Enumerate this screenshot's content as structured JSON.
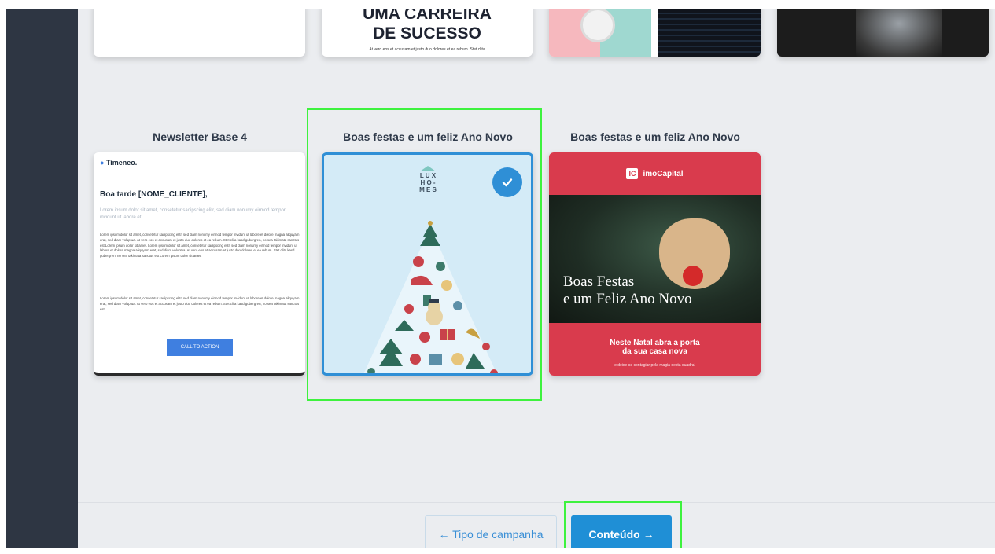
{
  "top_row": {
    "career_card": {
      "heading_line1": "UMA CARREIRA",
      "heading_line2": "DE SUCESSO",
      "caption": "At vero eos et accusam et justo duo dolores et ea rebum. Stet clita"
    }
  },
  "templates": [
    {
      "title": "Newsletter Base 4",
      "selected": false,
      "logo": "Timeneo.",
      "greeting": "Boa tarde [NOME_CLIENTE],",
      "lead": "Lorem ipsum dolor sit amet, consetetur sadipscing elitr, sed diam nonumy eirmod tempor invidunt ut labore et.",
      "body1": "Lorem ipsum dolor sit amet, consetetur sadipscing elitr, sed diam nonumy eirmod tempor invidunt ut labore et dolore magna aliquyam erat, sed diam voluptua. At vero eos et accusam et justo duo dolores et ea rebum. Stet clita kasd gubergren, no sea takimata sanctus est Lorem ipsum dolor sit amet. Lorem ipsum dolor sit amet, consetetur sadipscing elitr, sed diam nonumy eirmod tempor invidunt ut labore et dolore magna aliquyam erat, sed diam voluptua. At vero eos et accusam et justo duo dolores et ea rebum. Stet clita kasd gubergren, no sea takimata sanctus est Lorem ipsum dolor sit amet.",
      "body2": "Lorem ipsum dolor sit amet, consetetur sadipscing elitr, sed diam nonumy eirmod tempor invidunt ut labore et dolore magna aliquyam erat, sed diam voluptua. At vero eos et accusam et justo duo dolores et ea rebum. Stet clita kasd gubergren, no sea takimata sanctus est.",
      "cta": "CALL TO ACTION"
    },
    {
      "title": "Boas festas e um feliz Ano Novo",
      "selected": true,
      "logo_lines": [
        "L U X",
        "H O -",
        "M E S"
      ],
      "background": "#d4ebf7"
    },
    {
      "title": "Boas festas e um feliz Ano Novo",
      "selected": false,
      "brand_mark": "IC",
      "brand_name": "imoCapital",
      "headline_line1": "Boas Festas",
      "headline_line2": "e um Feliz Ano Novo",
      "sub_line1": "Neste Natal abra a porta",
      "sub_line2": "da sua casa nova",
      "small": "e deixe-se contagiar pela magia desta quadra!"
    }
  ],
  "footer": {
    "back_label": "← Tipo de campanha",
    "next_label": "Conteúdo →"
  },
  "colors": {
    "sidebar": "#2e3643",
    "content_bg": "#ebedf0",
    "accent": "#1f8fd6",
    "highlight": "#3ef23e",
    "imo_red": "#d93b4d"
  },
  "icons": {
    "selected_check": "check-icon"
  }
}
